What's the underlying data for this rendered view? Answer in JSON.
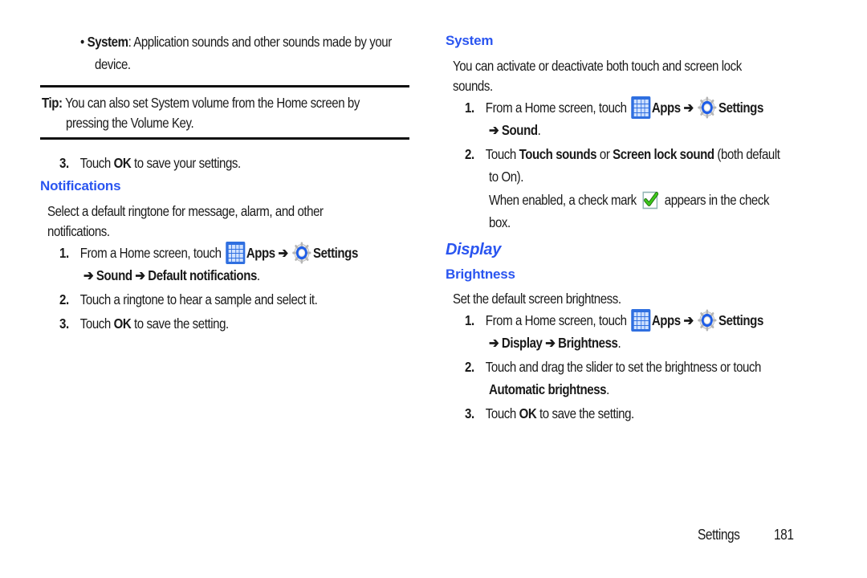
{
  "left_column": {
    "bullet_system": {
      "label": "System",
      "text_line1": ": Application sounds and other sounds made by your",
      "text_line2": "device."
    },
    "tip": {
      "label": "Tip:",
      "line1": " You can also set System volume from the Home screen by",
      "line2": "pressing the Volume Key."
    },
    "step3_save": {
      "number": "3.",
      "pre": "Touch ",
      "bold": "OK",
      "post": " to save your settings."
    },
    "notifications": {
      "heading": "Notifications",
      "intro_line1": "Select a default ringtone for message, alarm, and other",
      "intro_line2": "notifications.",
      "steps": [
        {
          "number": "1.",
          "pre": "From a Home screen, touch ",
          "apps": "Apps",
          "arrow": " ➔ ",
          "settings": "Settings",
          "path": "➔ Sound ➔ Default notifications",
          "end": "."
        },
        {
          "number": "2.",
          "text": "Touch a ringtone to hear a sample and select it."
        },
        {
          "number": "3.",
          "pre": "Touch ",
          "bold": "OK",
          "post": " to save the setting."
        }
      ]
    }
  },
  "right_column": {
    "system": {
      "heading": "System",
      "intro_line1": "You can activate or deactivate both touch and screen lock",
      "intro_line2": "sounds.",
      "steps": [
        {
          "number": "1.",
          "pre": "From a Home screen, touch ",
          "apps": "Apps",
          "arrow": " ➔ ",
          "settings": "Settings",
          "path": "➔ Sound",
          "end": "."
        },
        {
          "number": "2.",
          "pre": "Touch ",
          "bold1": "Touch sounds",
          "mid": " or ",
          "bold2": "Screen lock sound",
          "post": " (both default",
          "line2": "to On).",
          "note_pre": "When enabled, a check mark ",
          "note_post": " appears in the check",
          "note_line2": "box."
        }
      ]
    },
    "display": {
      "heading": "Display",
      "brightness": {
        "heading": "Brightness",
        "intro": "Set the default screen brightness.",
        "steps": [
          {
            "number": "1.",
            "pre": "From a Home screen, touch ",
            "apps": "Apps",
            "arrow": " ➔ ",
            "settings": "Settings",
            "path": "➔ Display ➔ Brightness",
            "end": "."
          },
          {
            "number": "2.",
            "line1": "Touch and drag the slider to set the brightness or touch",
            "bold": "Automatic brightness",
            "end": "."
          },
          {
            "number": "3.",
            "pre": "Touch ",
            "bold": "OK",
            "post": " to save the setting."
          }
        ]
      }
    }
  },
  "footer": {
    "section": "Settings",
    "page_number": "181"
  },
  "icons": {
    "apps": "apps-grid-icon",
    "settings": "settings-gear-icon",
    "checkbox": "checked-checkbox-icon"
  },
  "colors": {
    "heading_blue": "#2a55f0",
    "apps_icon_blue": "#2f6fe0",
    "settings_ring_blue": "#1f5ee8",
    "check_green": "#3bc81a",
    "text": "#1a1a1a"
  }
}
